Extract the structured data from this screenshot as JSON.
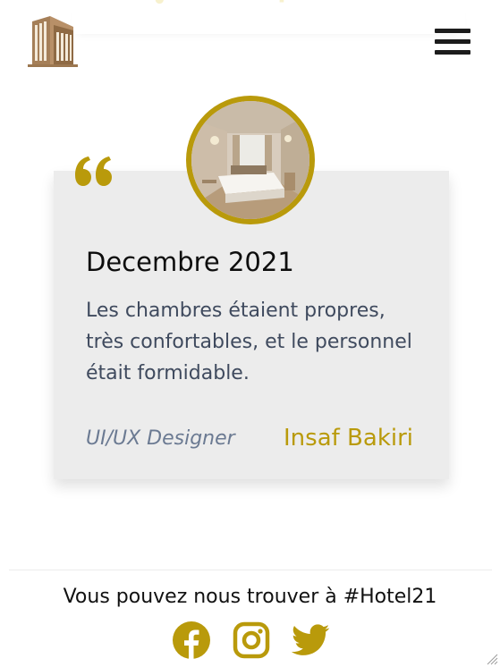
{
  "header": {
    "logo_icon": "hotel-building-icon",
    "menu_icon": "hamburger-menu-icon"
  },
  "review": {
    "date": "Decembre 2021",
    "text": "Les chambres étaient propres, très confortables, et le personnel était formidable.",
    "reviewer_role": "UI/UX Designer",
    "reviewer_name": "Insaf Bakiri",
    "quote_icon": "quote-icon",
    "photo_subject": "hotel-room-photo"
  },
  "footer": {
    "text": "Vous pouvez nous trouver à #Hotel21",
    "social_icons": [
      "facebook-icon",
      "instagram-icon",
      "twitter-icon"
    ]
  },
  "colors": {
    "accent": "#b99a0b",
    "card_background": "#ececec",
    "body_text": "#3f4a5e",
    "role_text": "#6b7a92",
    "logo_brown": "#9c7750"
  }
}
